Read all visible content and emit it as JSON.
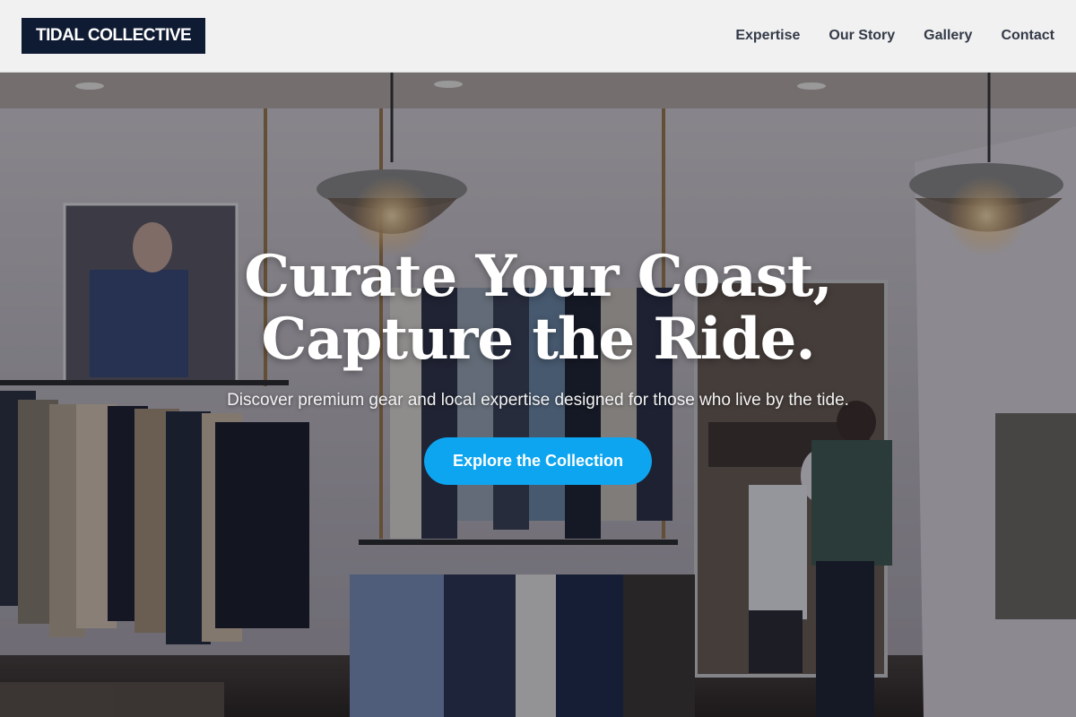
{
  "header": {
    "logo": "TIDAL COLLECTIVE",
    "nav": [
      {
        "label": "Expertise"
      },
      {
        "label": "Our Story"
      },
      {
        "label": "Gallery"
      },
      {
        "label": "Contact"
      }
    ]
  },
  "hero": {
    "headline_line1": "Curate Your Coast,",
    "headline_line2": "Capture the Ride.",
    "subheadline": "Discover premium gear and local expertise designed for those who live by the tide.",
    "cta_label": "Explore the Collection",
    "background": "clothing store interior with hanging racks and pendant lamps"
  },
  "colors": {
    "logo_bg": "#0f1b33",
    "header_bg": "#f1f1f1",
    "nav_text": "#333a48",
    "cta_bg": "#0ea5f0",
    "hero_text": "#ffffff"
  }
}
